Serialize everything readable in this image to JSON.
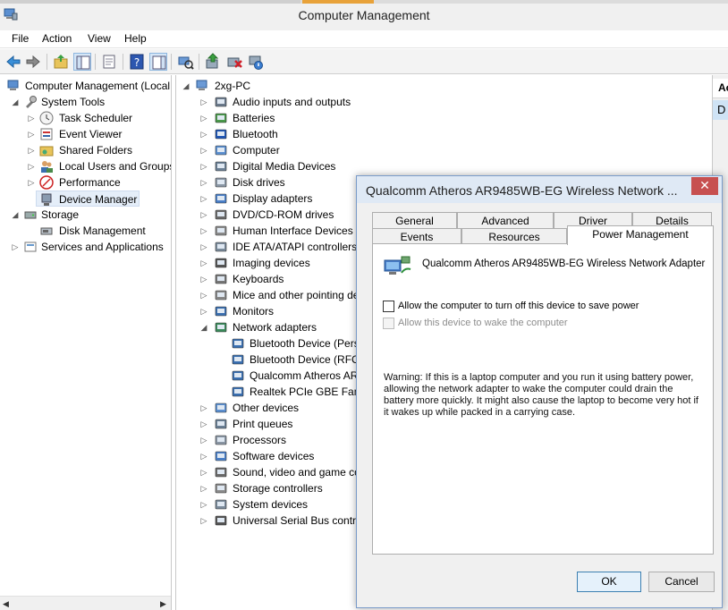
{
  "window": {
    "title": "Computer Management"
  },
  "menu": {
    "items": [
      "File",
      "Action",
      "View",
      "Help"
    ]
  },
  "toolbar": {
    "icons": [
      "back-arrow-icon",
      "forward-arrow-icon",
      "up-folder-icon",
      "show-tree-icon",
      "properties-icon",
      "help-icon",
      "action-pane-icon",
      "scan-hardware-icon",
      "update-driver-icon",
      "uninstall-icon",
      "disable-icon"
    ]
  },
  "left_tree": {
    "root": "Computer Management (Local",
    "system_tools": "System Tools",
    "task_scheduler": "Task Scheduler",
    "event_viewer": "Event Viewer",
    "shared_folders": "Shared Folders",
    "local_users": "Local Users and Groups",
    "performance": "Performance",
    "device_manager": "Device Manager",
    "storage": "Storage",
    "disk_management": "Disk Management",
    "services": "Services and Applications"
  },
  "device_tree": {
    "root": "2xg-PC",
    "categories": [
      "Audio inputs and outputs",
      "Batteries",
      "Bluetooth",
      "Computer",
      "Digital Media Devices",
      "Disk drives",
      "Display adapters",
      "DVD/CD-ROM drives",
      "Human Interface Devices",
      "IDE ATA/ATAPI controllers",
      "Imaging devices",
      "Keyboards",
      "Mice and other pointing de",
      "Monitors",
      "Network adapters"
    ],
    "network_children": [
      "Bluetooth Device (Perso",
      "Bluetooth Device (RFCO",
      "Qualcomm Atheros AR",
      "Realtek PCIe GBE Famil"
    ],
    "more_categories": [
      "Other devices",
      "Print queues",
      "Processors",
      "Software devices",
      "Sound, video and game co",
      "Storage controllers",
      "System devices",
      "Universal Serial Bus contro"
    ]
  },
  "actions_pane": {
    "header": "Ac",
    "selected": "D"
  },
  "dialog": {
    "title": "Qualcomm Atheros AR9485WB-EG Wireless Network ...",
    "close": "✕",
    "tabs_row1": [
      "General",
      "Advanced",
      "Driver",
      "Details"
    ],
    "tabs_row2": [
      "Events",
      "Resources",
      "Power Management"
    ],
    "device_name": "Qualcomm Atheros AR9485WB-EG Wireless Network Adapter",
    "allow_turn_off": "Allow the computer to turn off this device to save power",
    "allow_wake": "Allow this device to wake the computer",
    "warning": "Warning: If this is a laptop computer and you run it using battery power, allowing the network adapter to wake the computer could drain the battery more quickly. It might also cause the laptop to become very hot if it wakes up while packed in a carrying case.",
    "ok": "OK",
    "cancel": "Cancel"
  },
  "colors": {
    "accent": "#3c7fb1",
    "close_red": "#c75050",
    "selection": "#cfe3f5"
  }
}
